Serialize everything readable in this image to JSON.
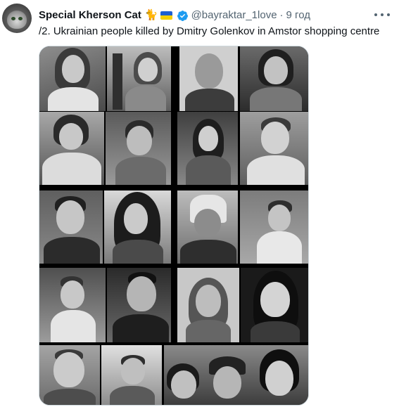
{
  "tweet": {
    "display_name": "Special Kherson Cat",
    "name_emoji_1": "🐈",
    "name_emoji_2": "ukraine-flag",
    "verified_icon": "verified-badge-icon",
    "handle": "@bayraktar_1love",
    "separator": "·",
    "time": "9 год",
    "text": "/2. Ukrainian people killed by Dmitry Golenkov in Amstor shopping centre",
    "more_icon": "ellipsis-icon",
    "media": {
      "description_icon": "photo-collage",
      "photo_count": 20
    }
  },
  "colors": {
    "primary_text": "#0f1419",
    "secondary_text": "#536471",
    "verified_blue": "#1d9bf0",
    "flag_blue": "#1d5fd1",
    "flag_yellow": "#f5d000",
    "media_border": "#cfd9de"
  }
}
